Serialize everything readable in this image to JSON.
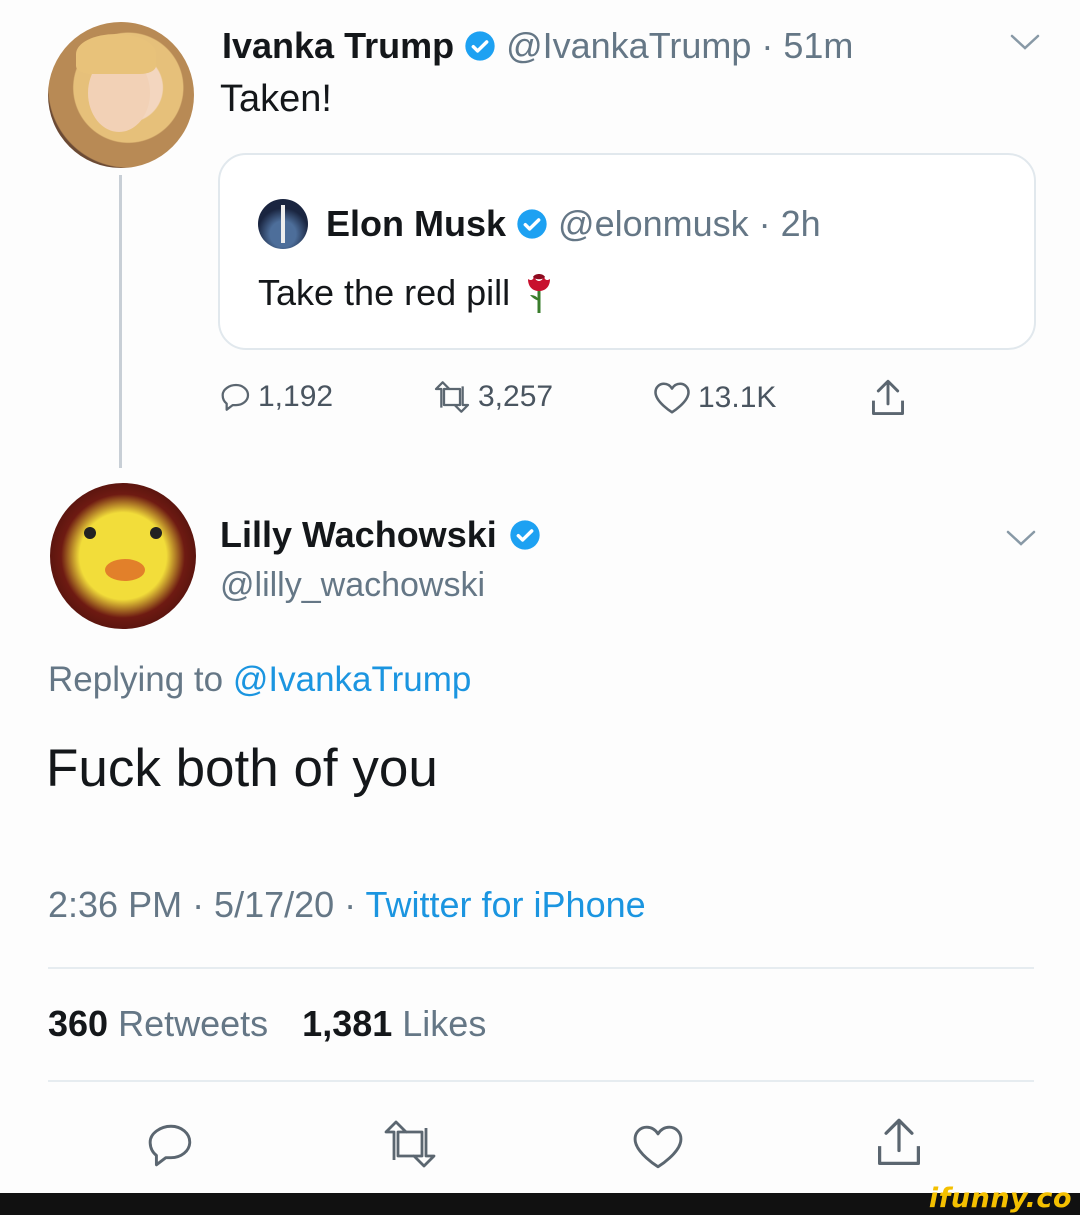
{
  "original_tweet": {
    "author_name": "Ivanka Trump",
    "handle": "@IvankaTrump",
    "time": "51m",
    "separator": "·",
    "text": "Taken!",
    "quoted": {
      "author_name": "Elon Musk",
      "handle": "@elonmusk",
      "time": "2h",
      "separator": "·",
      "text": "Take the red pill",
      "emoji": "🌹"
    },
    "stats": {
      "replies": "1,192",
      "retweets": "3,257",
      "likes": "13.1K"
    }
  },
  "reply_tweet": {
    "author_name": "Lilly Wachowski",
    "handle": "@lilly_wachowski",
    "replying_label": "Replying to",
    "replying_handle": "@IvankaTrump",
    "text": "Fuck both of you",
    "timestamp": "2:36 PM · 5/17/20 · ",
    "client": "Twitter for iPhone",
    "retweets_count": "360",
    "retweets_label": "Retweets",
    "likes_count": "1,381",
    "likes_label": "Likes"
  },
  "watermark": "ifunny.co",
  "colors": {
    "accent": "#1b95e0",
    "verified": "#1da1f2",
    "rose": "#c8102e"
  }
}
